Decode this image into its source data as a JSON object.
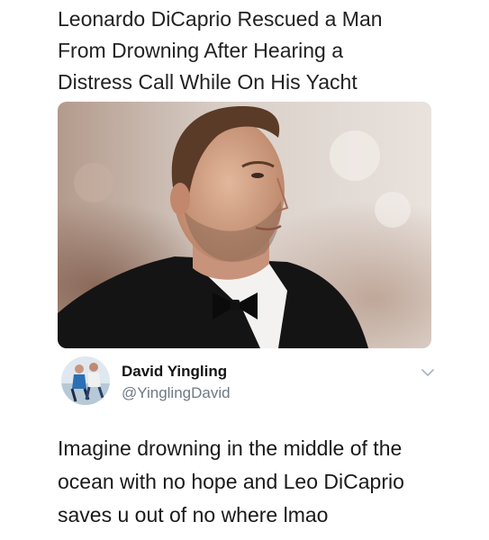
{
  "headline": {
    "lines": [
      "Leonardo DiCaprio Rescued a Man",
      "From Drowning After Hearing a",
      "Distress Call While On His Yacht"
    ]
  },
  "photo": {
    "subject": "man-in-tuxedo-photo"
  },
  "tweet": {
    "display_name": "David Yingling",
    "handle": "@YinglingDavid",
    "text_lines": [
      "Imagine drowning in the middle of the",
      "ocean with no hope and Leo DiCaprio",
      "saves u out of no where lmao"
    ],
    "menu_icon": "chevron-down-icon"
  },
  "colors": {
    "background": "#ffffff",
    "text": "#1a1a1a",
    "handle": "#6e7a85",
    "chevron": "#aab4bd"
  }
}
